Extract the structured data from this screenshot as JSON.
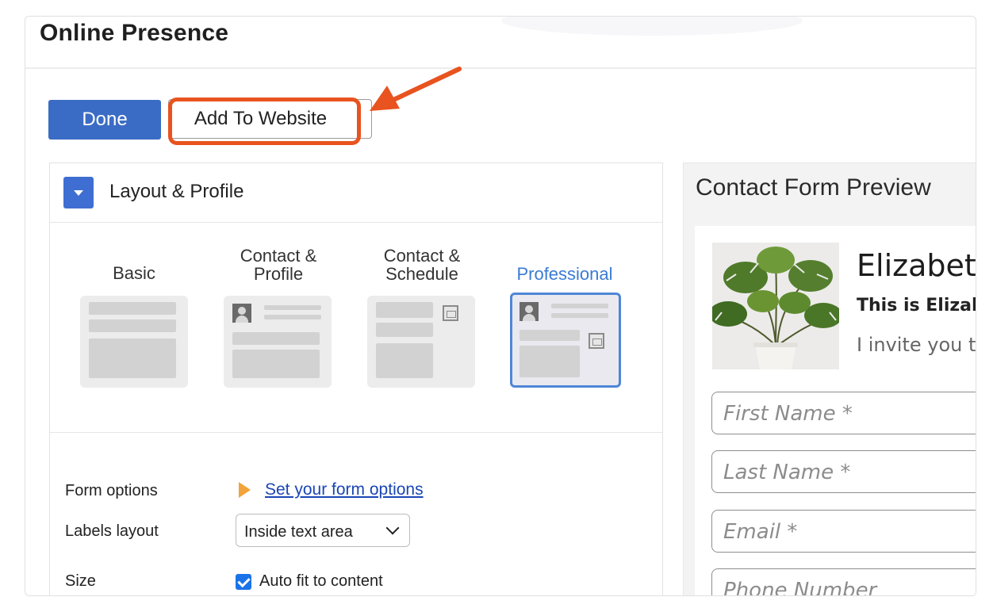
{
  "header": {
    "title": "Online Presence"
  },
  "toolbar": {
    "done_label": "Done",
    "add_to_website_label": "Add To Website"
  },
  "layout_section": {
    "title": "Layout & Profile",
    "options": [
      {
        "label_line1": "Basic",
        "label_line2": "",
        "selected": false
      },
      {
        "label_line1": "Contact &",
        "label_line2": "Profile",
        "selected": false
      },
      {
        "label_line1": "Contact &",
        "label_line2": "Schedule",
        "selected": false
      },
      {
        "label_line1": "Professional",
        "label_line2": "",
        "selected": true
      }
    ]
  },
  "form_options": {
    "label": "Form options",
    "link_text": "Set your form options",
    "labels_layout_label": "Labels layout",
    "labels_layout_value": "Inside text area",
    "size_label": "Size",
    "auto_fit_label": "Auto fit to content",
    "auto_fit_checked": true
  },
  "preview": {
    "title": "Contact Form Preview",
    "name": "Elizabeth",
    "subtitle": "This is Elizal",
    "text": "I invite you t",
    "fields": [
      {
        "placeholder": "First Name *"
      },
      {
        "placeholder": "Last Name *"
      },
      {
        "placeholder": "Email *"
      },
      {
        "placeholder": "Phone Number"
      }
    ]
  },
  "colors": {
    "accent": "#3b6cc5",
    "highlight": "#e8531f",
    "selected_layout": "#3a7bd5",
    "link": "#1a46b4"
  },
  "icons": [
    "collapse-toggle-icon",
    "play-icon",
    "avatar-icon",
    "calendar-icon",
    "chevron-down-icon",
    "checkmark-icon"
  ]
}
